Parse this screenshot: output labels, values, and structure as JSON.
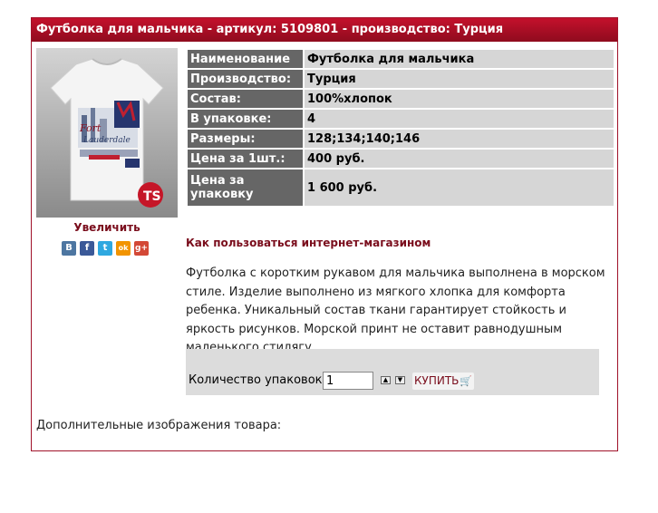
{
  "product": {
    "header": "Футболка для мальчика - артикул: 5109801 - производство: Турция",
    "zoom_label": "Увеличить",
    "howto_link": "Как пользоваться интернет-магазином",
    "description": "Футболка с коротким рукавом для мальчика выполнена в морском стиле. Изделие выполнено из мягкого хлопка  для комфорта ребенка. Уникальный состав ткани гарантирует стойкость и яркость рисунков. Морской принт не оставит равнодушным маленького стилягу.",
    "extra_images_label": "Дополнительные изображения товара:"
  },
  "specs": [
    {
      "key": "Наименование",
      "value": "Футболка для мальчика"
    },
    {
      "key": "Производство:",
      "value": "Турция"
    },
    {
      "key": "Состав:",
      "value": "100%хлопок"
    },
    {
      "key": "В упаковке:",
      "value": "4"
    },
    {
      "key": "Размеры:",
      "value": "128;134;140;146"
    },
    {
      "key": "Цена за 1шт.:",
      "value": "400 руб."
    },
    {
      "key": "Цена за упаковку",
      "value": "1 600 руб."
    }
  ],
  "share": [
    {
      "icon": "vk-icon",
      "glyph": "B",
      "color": "#4d76a1"
    },
    {
      "icon": "facebook-icon",
      "glyph": "f",
      "color": "#3b5998"
    },
    {
      "icon": "twitter-icon",
      "glyph": "t",
      "color": "#2fa8e0"
    },
    {
      "icon": "odnoklassniki-icon",
      "glyph": "ok",
      "color": "#f29400"
    },
    {
      "icon": "googleplus-icon",
      "glyph": "g+",
      "color": "#d34836"
    }
  ],
  "order": {
    "qty_label": "Количество упаковок:",
    "qty_value": "1",
    "buy_label": "КУПИТЬ"
  },
  "colors": {
    "accent": "#a0122a",
    "link": "#7a0d1c"
  }
}
